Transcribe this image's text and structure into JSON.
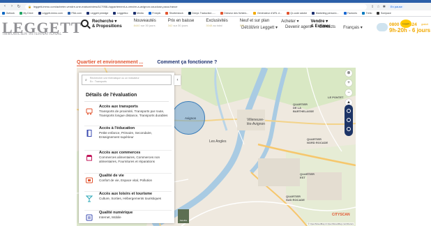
{
  "browser": {
    "url": "leggett-immo.com/acheter-vendre-une-maison/view/A17958-/appartement-a-vendre-a-avignon-vaucluse-paca-france",
    "profile_label": "En pause",
    "bookmarks": [
      {
        "label": "Outlook",
        "color": "#0a66c2"
      },
      {
        "label": "My Drive",
        "color": "#1fa463"
      },
      {
        "label": "Leggett-immo.com",
        "color": "#1c2f6e"
      },
      {
        "label": "FBA.com",
        "color": "#2b5fa8"
      },
      {
        "label": "Leggett prestige",
        "color": "#1c2f6e"
      },
      {
        "label": "Leggettcc",
        "color": "#1c2f6e"
      },
      {
        "label": "Media",
        "color": "#1c2f6e"
      },
      {
        "label": "Freepik",
        "color": "#1967d2"
      },
      {
        "label": "Shutterstock",
        "color": "#e2542f"
      },
      {
        "label": "DeepL Traduction -...",
        "color": "#0f2b46"
      },
      {
        "label": "Diviseur des fichiers...",
        "color": "#e2542f"
      },
      {
        "label": "Générateur d'URL d...",
        "color": "#f2a900"
      },
      {
        "label": "Qr-code adobe",
        "color": "#e2542f"
      },
      {
        "label": "Marketing personn...",
        "color": "#1c2f6e"
      },
      {
        "label": "Factures",
        "color": "#1967d2"
      },
      {
        "label": "Trello",
        "color": "#0079bf"
      },
      {
        "label": "Sonipace",
        "color": "#333333"
      }
    ]
  },
  "site": {
    "logo": "LEGGETT",
    "logo_sub": "IMMOBILIER INTERNATIONAL",
    "toplinks": [
      "Découvrir Leggett ▾",
      "Devenir agent",
      "Contacts",
      "Français ▾"
    ],
    "phone": "0800 900 324",
    "phone_free": "gratuit",
    "hours": "9h-20h - 6 jours /",
    "yellow_bubble": "Leggett",
    "nav": [
      {
        "title": "Recherche ▾",
        "sub": "& Propositions",
        "bold": true
      },
      {
        "title": "Nouveautés",
        "count": "8440",
        "suffix": " sur 30 jours"
      },
      {
        "title": "Prix en baisse",
        "count": "342",
        "suffix": " sur 30 jours"
      },
      {
        "title": "Exclusivités",
        "count": "3048",
        "suffix": " au total"
      },
      {
        "title": "Neuf et sur plan",
        "count": "595",
        "suffix": " au total"
      },
      {
        "title": "Acheter ▾",
        "sub": ""
      },
      {
        "title": "Vendre ▾",
        "sub": "& Estimer",
        "bold": true
      }
    ]
  },
  "tabs": {
    "active": "Quartier et environnement ...",
    "other": "Comment ça fonctionne ?"
  },
  "panel": {
    "search_placeholder_1": "Rechercher une thématique ou un indicateur",
    "search_placeholder_2": "Ex : Transports",
    "details_title": "Détails de l'évaluation",
    "criteria": [
      {
        "title": "Accès aux transports",
        "desc": "Transports de proximité, Transports par route, Transports longue distance, Transports durables",
        "icon": "bus-icon",
        "color": "#e2542f"
      },
      {
        "title": "Accès à l'éducation",
        "desc": "Petite enfance, Primaire, Secondaire, Enseignement supérieur",
        "icon": "book-icon",
        "color": "#3b4bb0"
      },
      {
        "title": "Accès aux commerces",
        "desc": "Commerces alimentaires, Commerces non alimentaires, Fournitures et réparations",
        "icon": "shop-icon",
        "color": "#c2185b"
      },
      {
        "title": "Qualité de vie",
        "desc": "Confort de vie, Espace vital, Pollution",
        "icon": "life-quality-icon",
        "color": "#e2542f"
      },
      {
        "title": "Accès aux loisirs et tourisme",
        "desc": "Culture, Sorties, Hébergements touristiques",
        "icon": "cocktail-icon",
        "color": "#2aa7b7"
      },
      {
        "title": "Qualité numérique",
        "desc": "Internet, Mobile",
        "icon": "digital-icon",
        "color": "#3b4bb0"
      }
    ]
  },
  "map": {
    "labels": {
      "villeneuve": "Villeneuve-\nlès-Avignon",
      "avignon": "Avignon",
      "les_angles": "Les Angles",
      "quartier_barthelasse": "QUARTIER\nDE LA\nBARTHELASSE",
      "quartier_sud": "QUARTIER\nSUD ROCADE",
      "quartier_est": "QUARTIER\nEST",
      "quartier_nord": "QUARTIER\nNORD ROCADE",
      "quartier_mt": "QUARTIER\nMONTFAVET",
      "le_pontet": "LE PONTET",
      "plan_label": "Satellite"
    },
    "attribution": "© OpenStreetMap & OpenStreetMap contributors",
    "cityscan": "CITYSCAN"
  }
}
